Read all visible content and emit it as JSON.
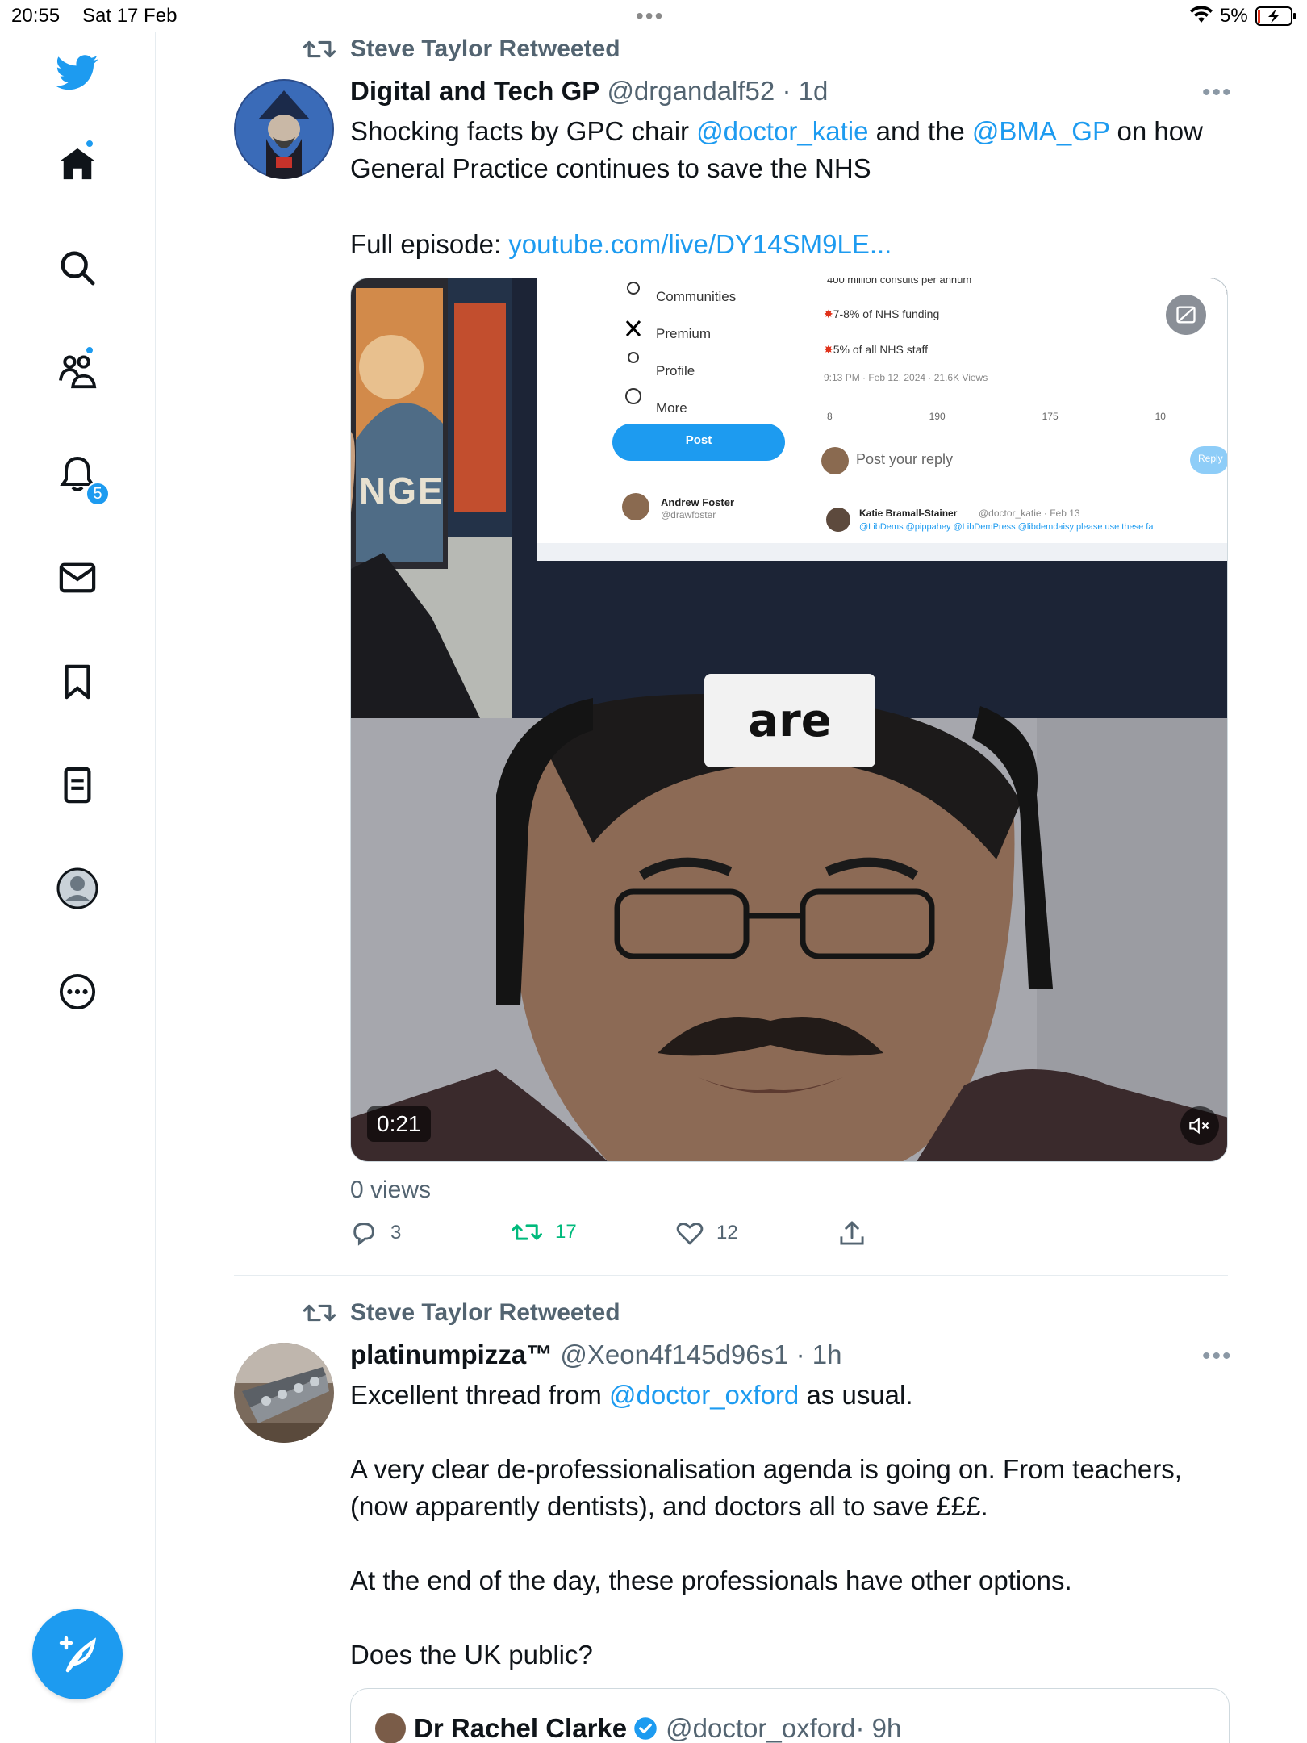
{
  "status_bar": {
    "time": "20:55",
    "date": "Sat 17 Feb",
    "battery": "5%"
  },
  "sidebar": {
    "notifications_badge": "5",
    "items": [
      "twitter-logo",
      "home",
      "search",
      "communities",
      "notifications",
      "messages",
      "bookmarks",
      "lists",
      "profile",
      "more"
    ]
  },
  "colors": {
    "accent": "#1d9bf0",
    "retweet_active": "#00ba7c",
    "muted": "#536471"
  },
  "tweets": [
    {
      "retweeted_by": "Steve Taylor Retweeted",
      "name": "Digital and Tech GP",
      "handle": "@drgandalf52",
      "time": "· 1d",
      "text_1a": "Shocking facts by GPC chair ",
      "mention_1": "@doctor_katie",
      "text_1b": " and the ",
      "mention_2": "@BMA_GP",
      "text_1c": " on how General Practice continues to save the NHS",
      "text_2a": "Full episode: ",
      "link": "youtube.com/live/DY14SM9LE...",
      "video": {
        "caption": "are",
        "timecode": "0:21",
        "screen_menu": [
          "Communities",
          "Premium",
          "Profile",
          "More"
        ],
        "screen_post_button": "Post",
        "screen_user_name": "Andrew Foster",
        "screen_user_handle": "@drawfoster",
        "screen_line_1": "400 million consults per annum",
        "screen_line_2": "7-8% of NHS funding",
        "screen_line_3": "5% of all NHS staff",
        "screen_meta": "9:13 PM · Feb 12, 2024 · 21.6K Views",
        "screen_reply_placeholder": "Post your reply",
        "screen_reply_button": "Reply",
        "screen_replier": "Katie Bramall-Stainer",
        "screen_replier_meta": "@doctor_katie · Feb 13",
        "screen_reply_text": "@LibDems @pippahey @LibDemPress @libdemdaisy please use these fa",
        "screen_counts": [
          "8",
          "190",
          "175",
          "10"
        ],
        "poster_text": "NGE"
      },
      "views": "0 views",
      "replies": "3",
      "retweets": "17",
      "likes": "12"
    },
    {
      "retweeted_by": "Steve Taylor Retweeted",
      "name": "platinumpizza™",
      "handle": "@Xeon4f145d96s1",
      "time": "· 1h",
      "text_1a": "Excellent thread from ",
      "mention_1": "@doctor_oxford",
      "text_1b": " as usual.",
      "text_2": "A very clear de-professionalisation agenda is going on. From teachers, (now apparently dentists), and doctors all to save £££.",
      "text_3": "At the end of the day, these professionals have other options.",
      "text_4": "Does the UK public?",
      "quote": {
        "name": "Dr Rachel Clarke",
        "handle": "@doctor_oxford",
        "time": "· 9h"
      }
    }
  ]
}
